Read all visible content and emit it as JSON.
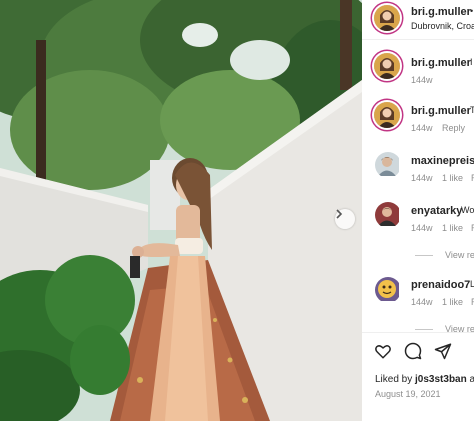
{
  "post": {
    "username": "bri.g.muller",
    "location": "Dubrovnik, Croa",
    "header_suffix": "•",
    "image_alt_icon": "chevron-right-icon"
  },
  "comments": [
    {
      "username": "bri.g.muller",
      "text": "I",
      "time": "144w",
      "likes": "",
      "reply": ""
    },
    {
      "username": "bri.g.muller",
      "text": "T",
      "time": "144w",
      "likes": "",
      "reply": "Reply"
    },
    {
      "username": "maxinepreiss",
      "text": "",
      "time": "144w",
      "likes": "1 like",
      "reply": "R",
      "view_replies": ""
    },
    {
      "username": "enyatarky",
      "text": "Wo",
      "time": "144w",
      "likes": "1 like",
      "reply": "R",
      "view_replies": "View re"
    },
    {
      "username": "prenaidoo7",
      "text": "L",
      "time": "144w",
      "likes": "1 like",
      "reply": "R",
      "view_replies": "View re"
    }
  ],
  "footer": {
    "liked_prefix": "Liked by ",
    "liked_user": "j0s3st3ban",
    "liked_suffix": " a",
    "date": "August 19, 2021"
  },
  "icons": {
    "like": "heart-icon",
    "comment": "comment-icon",
    "share": "share-icon"
  }
}
